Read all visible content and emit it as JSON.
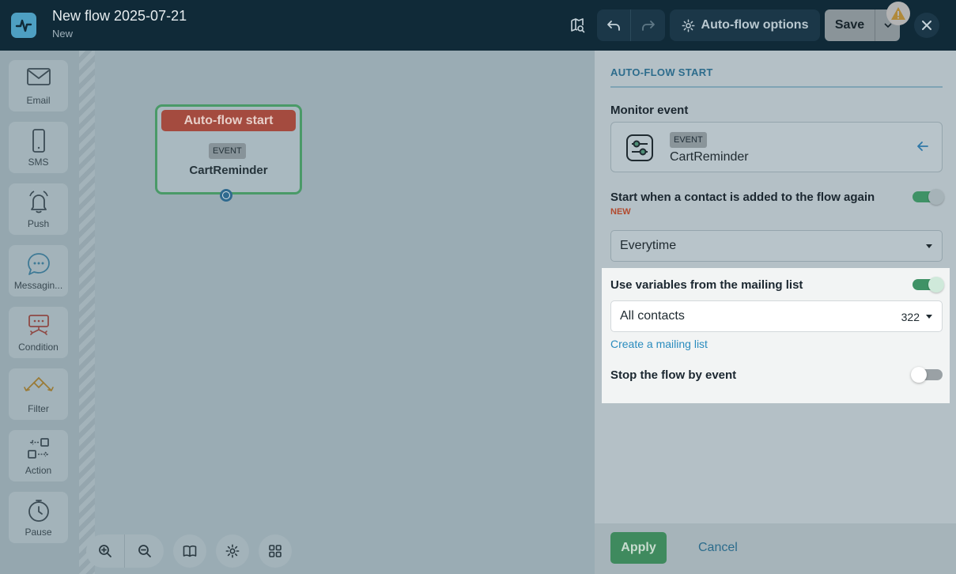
{
  "header": {
    "title": "New flow 2025-07-21",
    "subtitle": "New",
    "autoflow_options_label": "Auto-flow options",
    "save_label": "Save"
  },
  "sidebar": {
    "tools": [
      {
        "label": "Email",
        "icon": "mail-icon"
      },
      {
        "label": "SMS",
        "icon": "phone-icon"
      },
      {
        "label": "Push",
        "icon": "bell-icon"
      },
      {
        "label": "Messagin...",
        "icon": "chat-bubble-icon"
      },
      {
        "label": "Condition",
        "icon": "condition-icon"
      },
      {
        "label": "Filter",
        "icon": "filter-icon"
      },
      {
        "label": "Action",
        "icon": "action-icon"
      },
      {
        "label": "Pause",
        "icon": "clock-icon"
      }
    ]
  },
  "node": {
    "title": "Auto-flow start",
    "tag": "EVENT",
    "name": "CartReminder"
  },
  "panel": {
    "title": "AUTO-FLOW START",
    "monitor_label": "Monitor event",
    "event_tag": "EVENT",
    "event_name": "CartReminder",
    "restart_label": "Start when a contact is added to the flow again",
    "restart_badge": "NEW",
    "restart_enabled": true,
    "frequency_value": "Everytime",
    "variables_label": "Use variables from the mailing list",
    "variables_enabled": true,
    "mailing_list_value": "All contacts",
    "mailing_list_count": "322",
    "create_list_link": "Create a mailing list",
    "stop_label": "Stop the flow by event",
    "stop_enabled": false,
    "apply_label": "Apply",
    "cancel_label": "Cancel"
  },
  "colors": {
    "header_bg": "#102a38",
    "accent_green": "#3f8a5e",
    "node_head": "#a44b3f",
    "link_blue": "#2a8cbe"
  }
}
